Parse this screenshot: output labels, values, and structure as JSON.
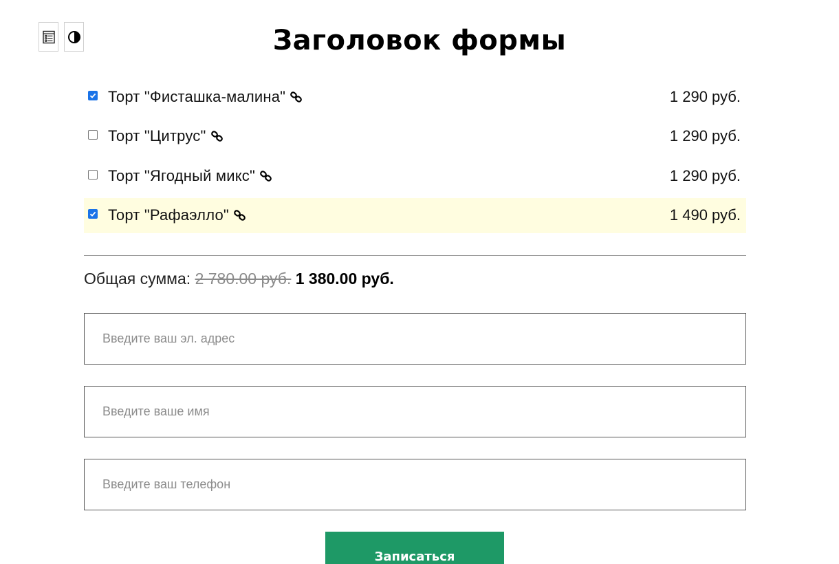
{
  "toolbar": {
    "icons": [
      "form-list-icon",
      "contrast-icon"
    ]
  },
  "form": {
    "title": "Заголовок формы"
  },
  "products": [
    {
      "name": "Торт \"Фисташка-малина\"",
      "price": "1 290 руб.",
      "checked": true,
      "highlighted": false
    },
    {
      "name": "Торт \"Цитрус\"",
      "price": "1 290 руб.",
      "checked": false,
      "highlighted": false
    },
    {
      "name": "Торт \"Ягодный микс\"",
      "price": "1 290 руб.",
      "checked": false,
      "highlighted": false
    },
    {
      "name": "Торт \"Рафаэлло\"",
      "price": "1 490 руб.",
      "checked": true,
      "highlighted": true
    }
  ],
  "total": {
    "label": "Общая сумма:",
    "old_value": "2 780.00 руб.",
    "new_value": "1 380.00 руб."
  },
  "fields": {
    "email_placeholder": "Введите ваш эл. адрес",
    "name_placeholder": "Введите ваше имя",
    "phone_placeholder": "Введите ваш телефон",
    "email_value": "",
    "name_value": "",
    "phone_value": ""
  },
  "submit": {
    "label": "Записаться"
  },
  "colors": {
    "accent_button": "#1e9966",
    "highlight_row": "#fffde0",
    "checkbox_checked": "#1a73e8"
  }
}
